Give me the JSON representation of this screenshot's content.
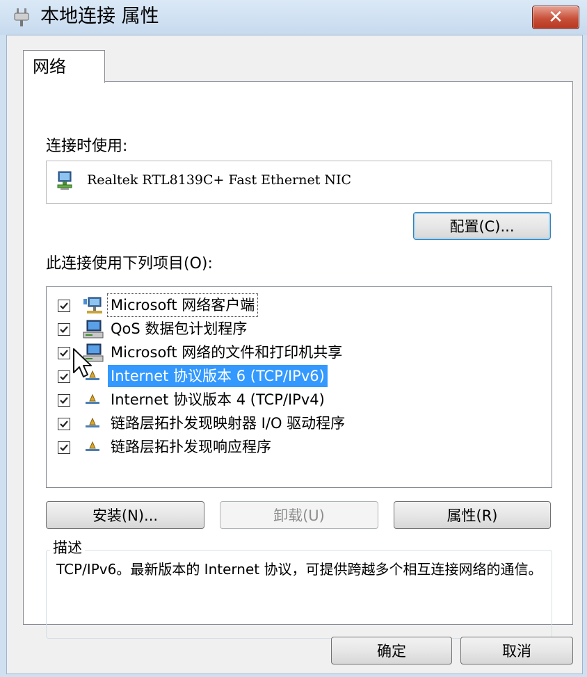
{
  "window": {
    "title": "本地连接 属性",
    "close_label": "✕",
    "title_icon": "network-plug-icon"
  },
  "tabs": [
    {
      "label": "网络",
      "selected": true
    }
  ],
  "connect_using": {
    "label": "连接时使用:",
    "adapter_name": "Realtek RTL8139C+ Fast Ethernet NIC",
    "adapter_icon": "network-adapter-icon",
    "configure_button": "配置(C)..."
  },
  "items_section": {
    "label": "此连接使用下列项目(O):",
    "items": [
      {
        "label": "Microsoft 网络客户端",
        "checked": true,
        "icon": "network-client-icon",
        "selected": false,
        "focused": true
      },
      {
        "label": "QoS 数据包计划程序",
        "checked": true,
        "icon": "computer-service-icon",
        "selected": false,
        "focused": false
      },
      {
        "label": "Microsoft 网络的文件和打印机共享",
        "checked": true,
        "icon": "computer-service-icon",
        "selected": false,
        "focused": false
      },
      {
        "label": "Internet 协议版本 6 (TCP/IPv6)",
        "checked": true,
        "icon": "protocol-icon",
        "selected": true,
        "focused": false
      },
      {
        "label": "Internet 协议版本 4 (TCP/IPv4)",
        "checked": true,
        "icon": "protocol-icon",
        "selected": false,
        "focused": false
      },
      {
        "label": "链路层拓扑发现映射器 I/O 驱动程序",
        "checked": true,
        "icon": "protocol-icon",
        "selected": false,
        "focused": false
      },
      {
        "label": "链路层拓扑发现响应程序",
        "checked": true,
        "icon": "protocol-icon",
        "selected": false,
        "focused": false
      }
    ]
  },
  "item_buttons": {
    "install": "安装(N)...",
    "uninstall": "卸载(U)",
    "properties": "属性(R)"
  },
  "description": {
    "legend": "描述",
    "text": "TCP/IPv6。最新版本的 Internet 协议，可提供跨越多个相互连接网络的通信。"
  },
  "footer": {
    "ok": "确定",
    "cancel": "取消"
  },
  "colors": {
    "selection": "#3399ff",
    "close_button": "#c8513a",
    "titlebar": "#cfe0f1"
  }
}
